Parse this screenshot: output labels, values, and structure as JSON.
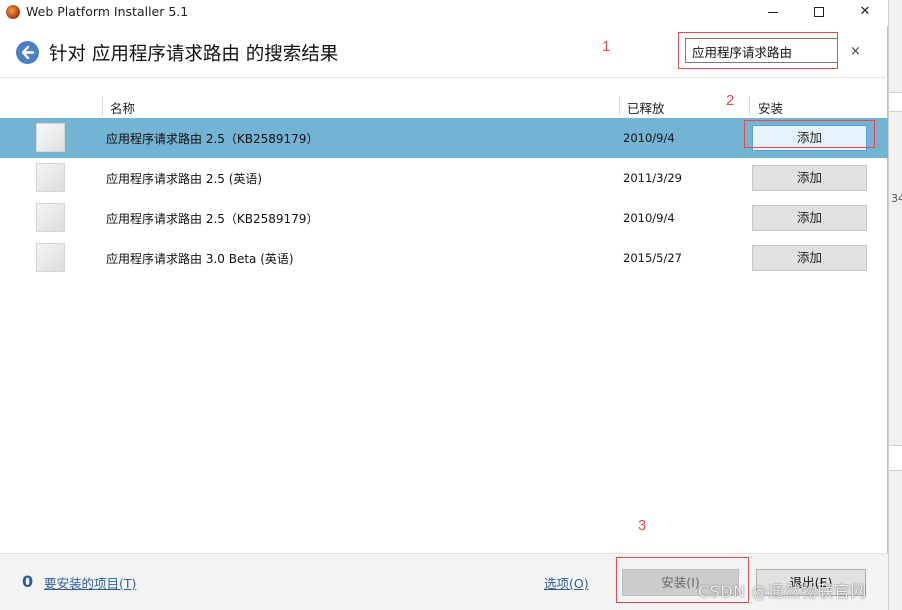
{
  "window": {
    "title": "Web Platform Installer 5.1",
    "minimize_glyph": "—",
    "maximize_glyph": "☐",
    "close_glyph": "✕"
  },
  "header": {
    "page_title": "针对 应用程序请求路由 的搜索结果",
    "search_value": "应用程序请求路由",
    "clear_glyph": "×"
  },
  "table": {
    "columns": {
      "name": "名称",
      "released": "已释放",
      "install": "安装"
    },
    "rows": [
      {
        "name": "应用程序请求路由 2.5（KB2589179）",
        "date": "2010/9/4",
        "action": "添加",
        "selected": true
      },
      {
        "name": "应用程序请求路由 2.5 (英语)",
        "date": "2011/3/29",
        "action": "添加",
        "selected": false
      },
      {
        "name": "应用程序请求路由 2.5（KB2589179）",
        "date": "2010/9/4",
        "action": "添加",
        "selected": false
      },
      {
        "name": "应用程序请求路由 3.0 Beta (英语)",
        "date": "2015/5/27",
        "action": "添加",
        "selected": false
      }
    ]
  },
  "footer": {
    "count": "0",
    "to_install_label": "要安装的项目(T)",
    "options_label": "选项(O)",
    "install_label": "安装(I)",
    "exit_label": "退出(E)"
  },
  "annotations": {
    "n1": "1",
    "n2": "2",
    "n3": "3"
  },
  "watermark": "CSDN @通然物联官网",
  "background_fragment": "34",
  "colors": {
    "selected_row": "#73b3d3",
    "link": "#2f5f9a",
    "annotation": "#e84a4a",
    "back_button": "#4a80c2"
  }
}
